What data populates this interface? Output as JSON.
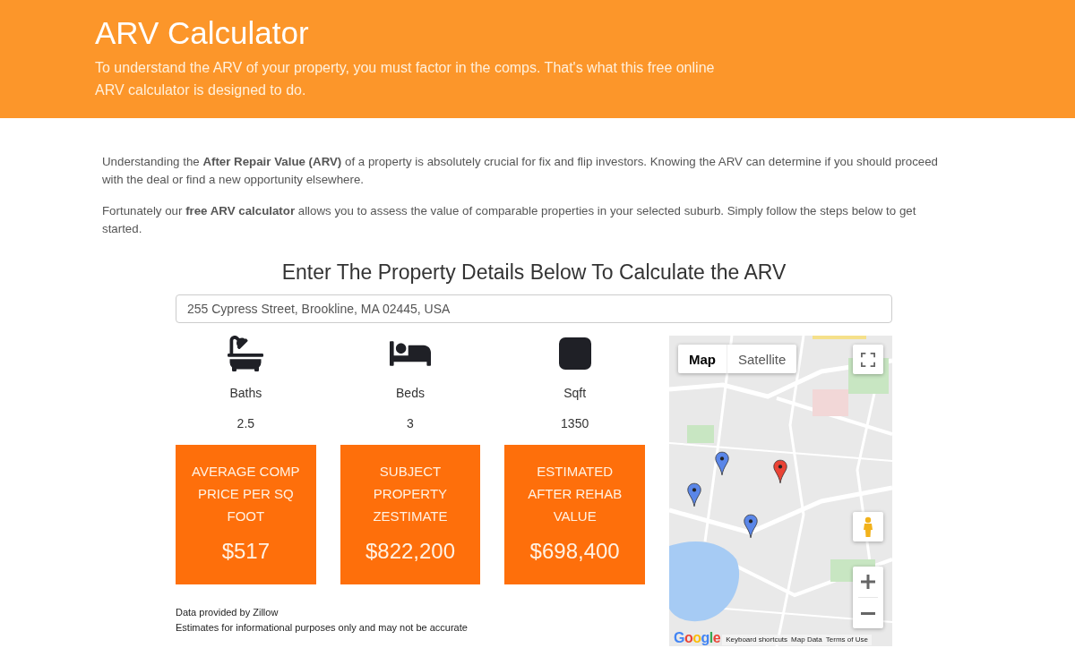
{
  "header": {
    "title": "ARV Calculator",
    "subtitle": "To understand the ARV of your property, you must factor in the comps. That's what this free online ARV calculator is designed to do."
  },
  "intro": [
    "Understanding the **After Repair Value (ARV)** of a property is absolutely crucial for fix and flip investors. Knowing the ARV can determine if you should proceed with the deal or find a new opportunity elsewhere.",
    "Fortunately our **free ARV calculator** allows you to assess the value of comparable properties in your selected suburb. Simply follow the steps below to get started."
  ],
  "calculator": {
    "heading": "Enter The Property Details Below To Calculate the ARV",
    "address_field": {
      "value": "255 Cypress Street, Brookline, MA 02445, USA"
    },
    "stats": [
      {
        "kind": "bath",
        "label": "Baths",
        "value": "2.5"
      },
      {
        "kind": "bed",
        "label": "Beds",
        "value": "3"
      },
      {
        "kind": "area",
        "label": "Sqft",
        "value": "1350"
      }
    ],
    "results": [
      {
        "label": "AVERAGE COMP PRICE PER SQ FOOT",
        "value": "$517"
      },
      {
        "label": "SUBJECT PROPERTY ZESTIMATE",
        "value": "$822,200"
      },
      {
        "label": "ESTIMATED AFTER REHAB VALUE",
        "value": "$698,400"
      }
    ],
    "notes": [
      "Data provided by Zillow",
      "Estimates for informational purposes only and may not be accurate"
    ]
  },
  "map": {
    "type_tabs": [
      {
        "label": "Map",
        "selected": true
      },
      {
        "label": "Satellite",
        "selected": false
      }
    ],
    "markers": [
      {
        "color": "#5a86e8"
      },
      {
        "color": "#ea4335"
      },
      {
        "color": "#5a86e8"
      },
      {
        "color": "#5a86e8"
      }
    ],
    "logo": "Google",
    "footer_links": [
      "Keyboard shortcuts",
      "Map Data",
      "Terms of Use"
    ]
  }
}
